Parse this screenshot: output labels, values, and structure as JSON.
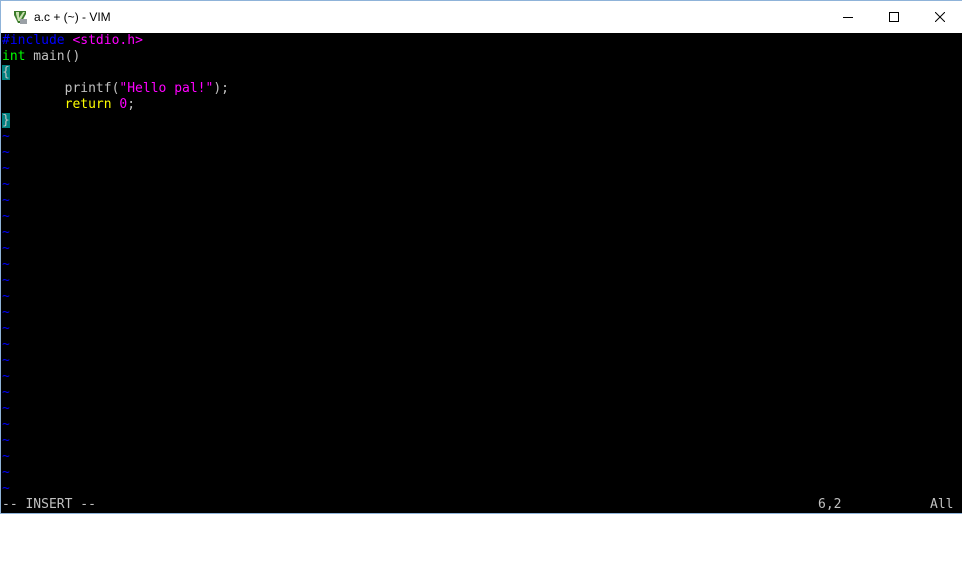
{
  "window": {
    "title": "a.c + (~) - VIM",
    "app_icon": "vim-icon",
    "controls": {
      "minimize": "minimize-icon",
      "maximize": "maximize-icon",
      "close": "close-icon"
    }
  },
  "editor": {
    "lines": [
      [
        {
          "text": "#include ",
          "cls": "kw-pre"
        },
        {
          "text": "<stdio.h>",
          "cls": "str"
        }
      ],
      [
        {
          "text": "int",
          "cls": "type"
        },
        {
          "text": " main()",
          "cls": "normal"
        }
      ],
      [
        {
          "text": "{",
          "cls": "brace-match"
        }
      ],
      [
        {
          "text": "        printf(",
          "cls": "normal"
        },
        {
          "text": "\"Hello pal!\"",
          "cls": "str"
        },
        {
          "text": ");",
          "cls": "normal"
        }
      ],
      [
        {
          "text": "        ",
          "cls": "normal"
        },
        {
          "text": "return",
          "cls": "stmt"
        },
        {
          "text": " ",
          "cls": "normal"
        },
        {
          "text": "0",
          "cls": "num"
        },
        {
          "text": ";",
          "cls": "normal"
        }
      ],
      [
        {
          "text": "}",
          "cls": "brace-match"
        }
      ]
    ],
    "empty_line_marker": "~",
    "empty_line_count": 23
  },
  "status": {
    "mode": "-- INSERT --",
    "cursor_position": "6,2",
    "scroll_position": "All"
  },
  "colors": {
    "preproc": "#0000ff",
    "string": "#ff00ff",
    "type": "#00ff00",
    "statement": "#ffff00",
    "match_paren_bg": "#008080",
    "background": "#000000"
  }
}
